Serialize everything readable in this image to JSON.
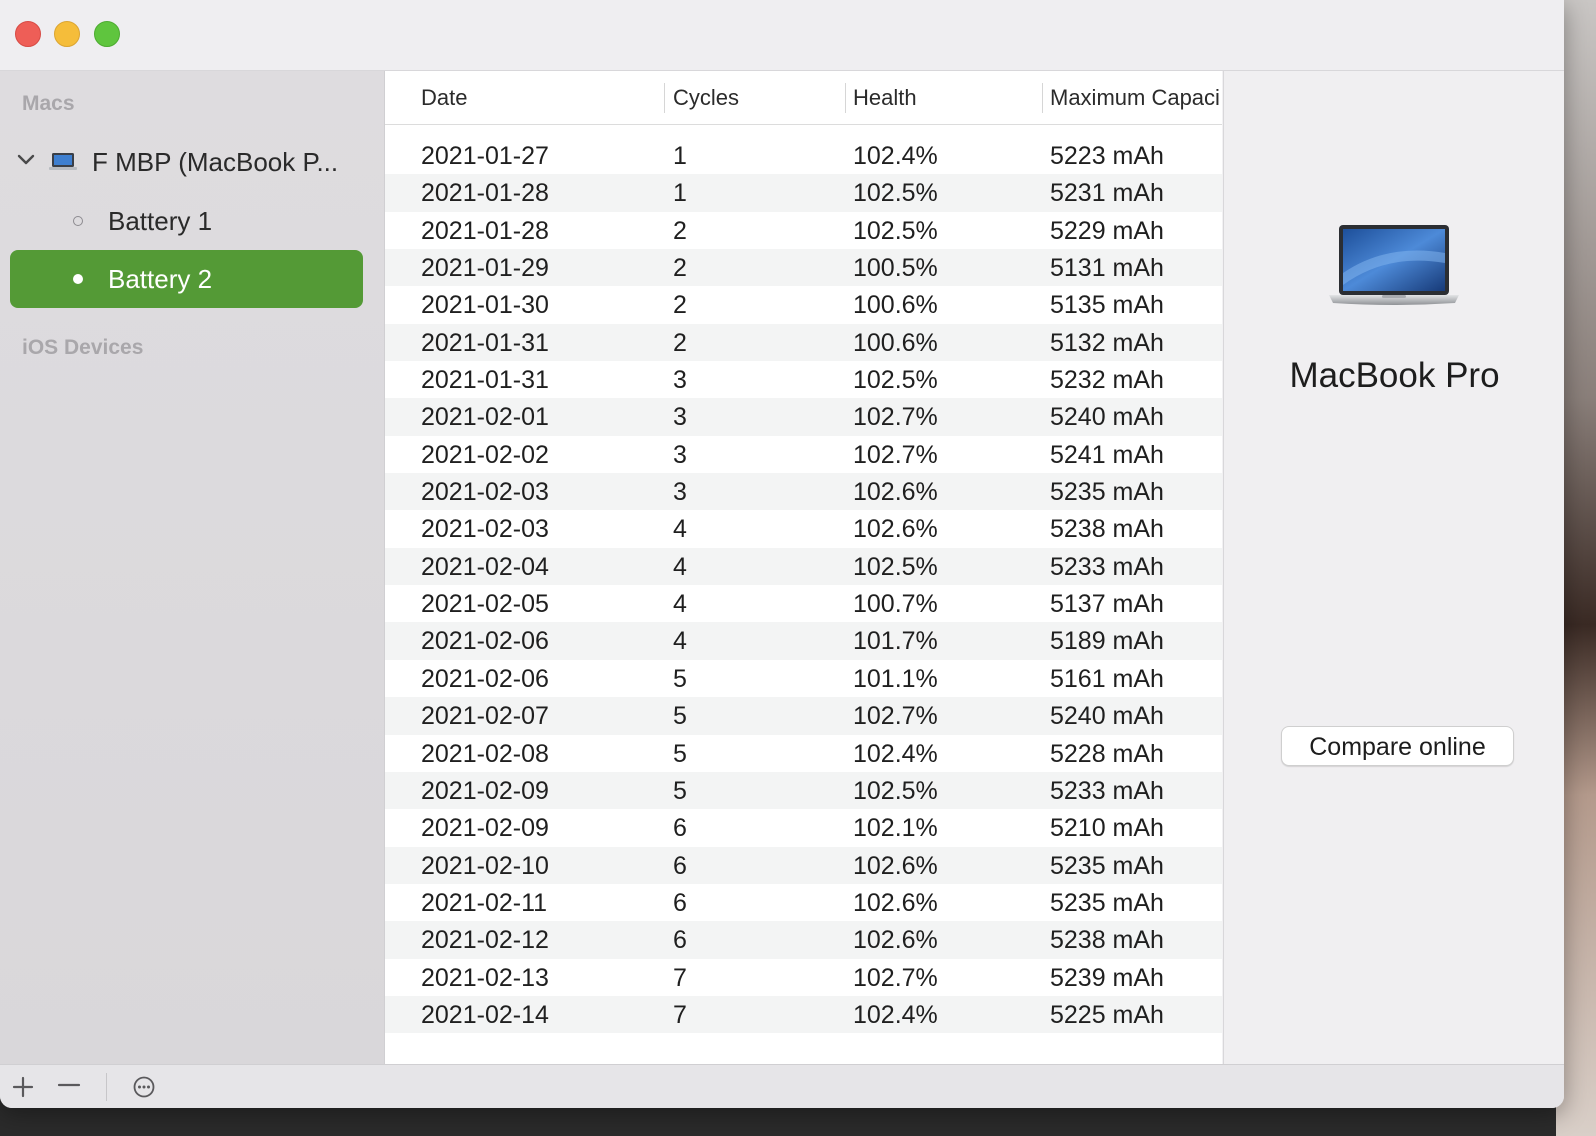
{
  "sidebar": {
    "sections": [
      {
        "header": "Macs"
      },
      {
        "header": "iOS Devices"
      }
    ],
    "device": {
      "label": "F MBP (MacBook P...",
      "expanded": true
    },
    "batteries": [
      {
        "label": "Battery 1",
        "selected": false
      },
      {
        "label": "Battery 2",
        "selected": true
      }
    ],
    "accent_color": "#549a36"
  },
  "table": {
    "columns": [
      "Date",
      "Cycles",
      "Health",
      "Maximum Capaci"
    ],
    "rows": [
      [
        "2021-01-27",
        "1",
        "102.4%",
        "5223 mAh"
      ],
      [
        "2021-01-28",
        "1",
        "102.5%",
        "5231 mAh"
      ],
      [
        "2021-01-28",
        "2",
        "102.5%",
        "5229 mAh"
      ],
      [
        "2021-01-29",
        "2",
        "100.5%",
        "5131 mAh"
      ],
      [
        "2021-01-30",
        "2",
        "100.6%",
        "5135 mAh"
      ],
      [
        "2021-01-31",
        "2",
        "100.6%",
        "5132 mAh"
      ],
      [
        "2021-01-31",
        "3",
        "102.5%",
        "5232 mAh"
      ],
      [
        "2021-02-01",
        "3",
        "102.7%",
        "5240 mAh"
      ],
      [
        "2021-02-02",
        "3",
        "102.7%",
        "5241 mAh"
      ],
      [
        "2021-02-03",
        "3",
        "102.6%",
        "5235 mAh"
      ],
      [
        "2021-02-03",
        "4",
        "102.6%",
        "5238 mAh"
      ],
      [
        "2021-02-04",
        "4",
        "102.5%",
        "5233 mAh"
      ],
      [
        "2021-02-05",
        "4",
        "100.7%",
        "5137 mAh"
      ],
      [
        "2021-02-06",
        "4",
        "101.7%",
        "5189 mAh"
      ],
      [
        "2021-02-06",
        "5",
        "101.1%",
        "5161 mAh"
      ],
      [
        "2021-02-07",
        "5",
        "102.7%",
        "5240 mAh"
      ],
      [
        "2021-02-08",
        "5",
        "102.4%",
        "5228 mAh"
      ],
      [
        "2021-02-09",
        "5",
        "102.5%",
        "5233 mAh"
      ],
      [
        "2021-02-09",
        "6",
        "102.1%",
        "5210 mAh"
      ],
      [
        "2021-02-10",
        "6",
        "102.6%",
        "5235 mAh"
      ],
      [
        "2021-02-11",
        "6",
        "102.6%",
        "5235 mAh"
      ],
      [
        "2021-02-12",
        "6",
        "102.6%",
        "5238 mAh"
      ],
      [
        "2021-02-13",
        "7",
        "102.7%",
        "5239 mAh"
      ],
      [
        "2021-02-14",
        "7",
        "102.4%",
        "5225 mAh"
      ]
    ]
  },
  "detail": {
    "icon": "macbook-icon",
    "model_name": "MacBook Pro",
    "compare_label": "Compare online"
  },
  "toolbar": {
    "icons": [
      "plus-icon",
      "minus-icon",
      "more-options-icon"
    ]
  }
}
